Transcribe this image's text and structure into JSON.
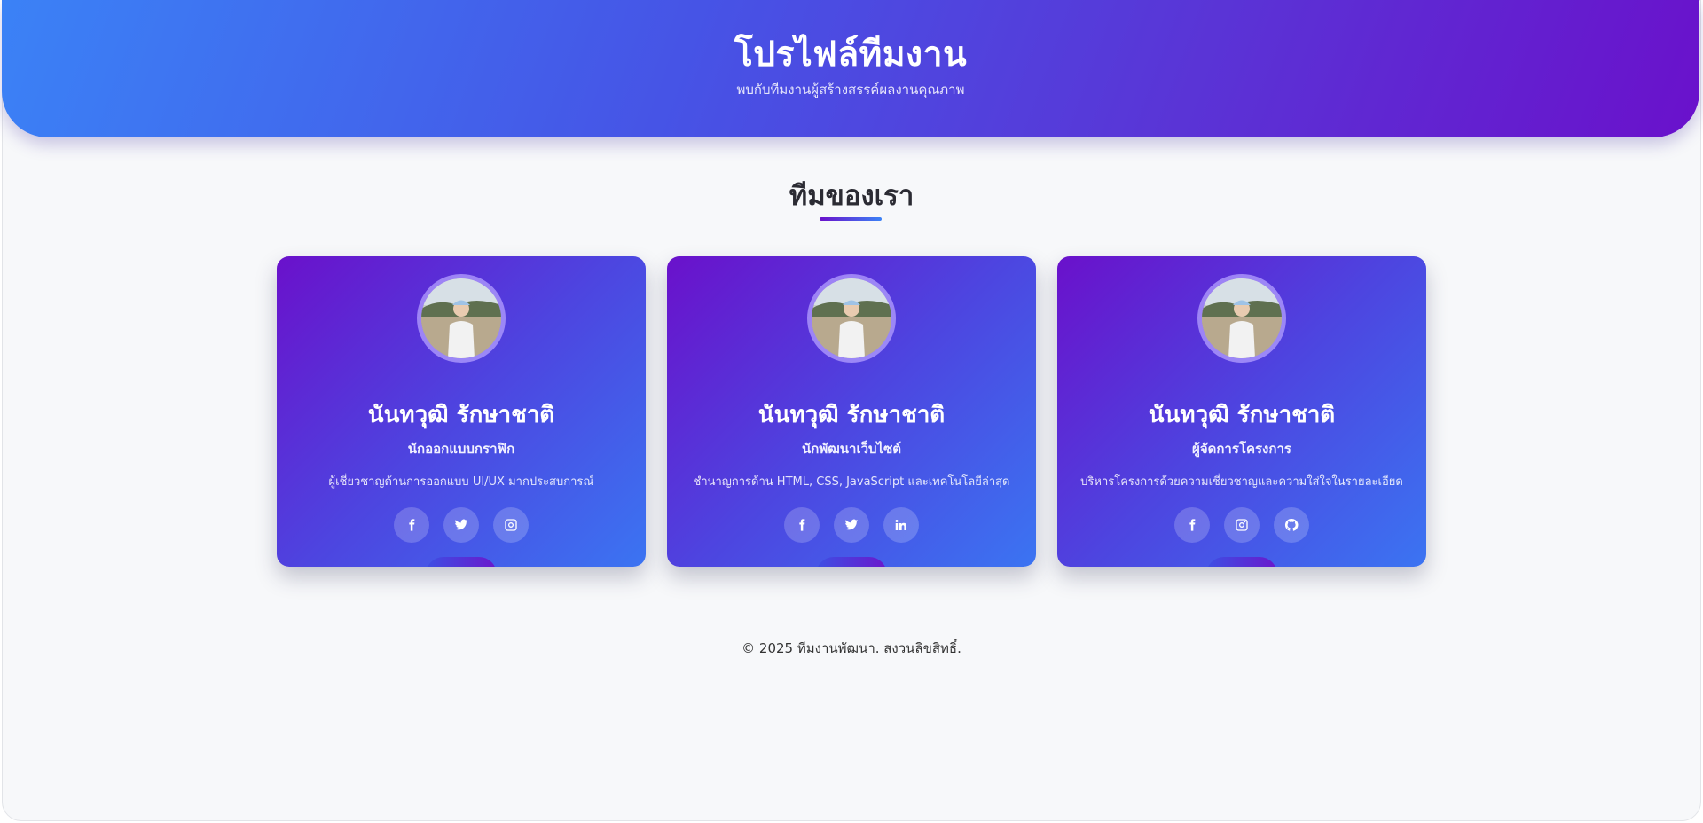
{
  "header": {
    "title": "โปรไฟล์ทีมงาน",
    "subtitle": "พบกับทีมงานผู้สร้างสรรค์ผลงานคุณภาพ"
  },
  "section": {
    "title": "ทีมของเรา"
  },
  "members": [
    {
      "name": "นันทวุฒิ รักษาชาติ",
      "role": "นักออกแบบกราฟิก",
      "bio": "ผู้เชี่ยวชาญด้านการออกแบบ UI/UX มากประสบการณ์",
      "socials": [
        "facebook-icon",
        "twitter-icon",
        "instagram-icon"
      ]
    },
    {
      "name": "นันทวุฒิ รักษาชาติ",
      "role": "นักพัฒนาเว็บไซต์",
      "bio": "ชำนาญการด้าน HTML, CSS, JavaScript และเทคโนโลยีล่าสุด",
      "socials": [
        "facebook-icon",
        "twitter-icon",
        "linkedin-icon"
      ]
    },
    {
      "name": "นันทวุฒิ รักษาชาติ",
      "role": "ผู้จัดการโครงการ",
      "bio": "บริหารโครงการด้วยความเชี่ยวชาญและความใส่ใจในรายละเอียด",
      "socials": [
        "facebook-icon",
        "instagram-icon",
        "github-icon"
      ]
    }
  ],
  "footer": {
    "text": "© 2025 ทีมงานพัฒนา. สงวนลิขสิทธิ์."
  },
  "colors": {
    "gradient_start": "#3b82f6",
    "gradient_end": "#6a11cb",
    "page_background": "#f7f8fa"
  }
}
